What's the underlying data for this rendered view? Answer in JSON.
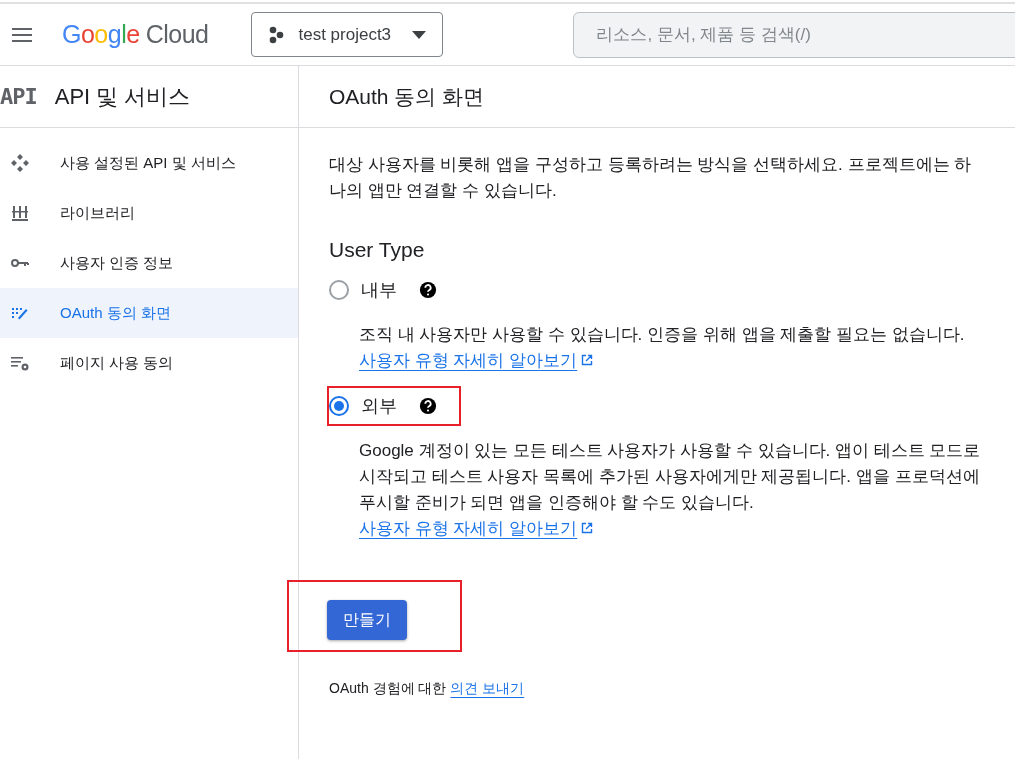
{
  "header": {
    "logo": {
      "brand": "Google",
      "product": "Cloud"
    },
    "project": "test project3",
    "search": {
      "placeholder": "리소스, 문서, 제품 등 검색(/)"
    }
  },
  "sidebar": {
    "badge": "API",
    "title": "API 및 서비스",
    "items": [
      {
        "label": "사용 설정된 API 및 서비스",
        "selected": false
      },
      {
        "label": "라이브러리",
        "selected": false
      },
      {
        "label": "사용자 인증 정보",
        "selected": false
      },
      {
        "label": "OAuth 동의 화면",
        "selected": true
      },
      {
        "label": "페이지 사용 동의",
        "selected": false
      }
    ]
  },
  "page": {
    "title": "OAuth 동의 화면",
    "intro": "대상 사용자를 비롯해 앱을 구성하고 등록하려는 방식을 선택하세요. 프로젝트에는 하나의 앱만 연결할 수 있습니다.",
    "user_type": {
      "heading": "User Type",
      "options": [
        {
          "label": "내부",
          "selected": false,
          "highlighted": false,
          "description": "조직 내 사용자만 사용할 수 있습니다. 인증을 위해 앱을 제출할 필요는 없습니다.",
          "link": "사용자 유형 자세히 알아보기"
        },
        {
          "label": "외부",
          "selected": true,
          "highlighted": true,
          "description": "Google 계정이 있는 모든 테스트 사용자가 사용할 수 있습니다. 앱이 테스트 모드로 시작되고 테스트 사용자 목록에 추가된 사용자에게만 제공됩니다. 앱을 프로덕션에 푸시할 준비가 되면 앱을 인증해야 할 수도 있습니다.",
          "link": "사용자 유형 자세히 알아보기"
        }
      ]
    },
    "create_button": {
      "label": "만들기",
      "highlighted": true
    },
    "feedback": {
      "text": "OAuth 경험에 대한",
      "link": "의견 보내기"
    }
  }
}
